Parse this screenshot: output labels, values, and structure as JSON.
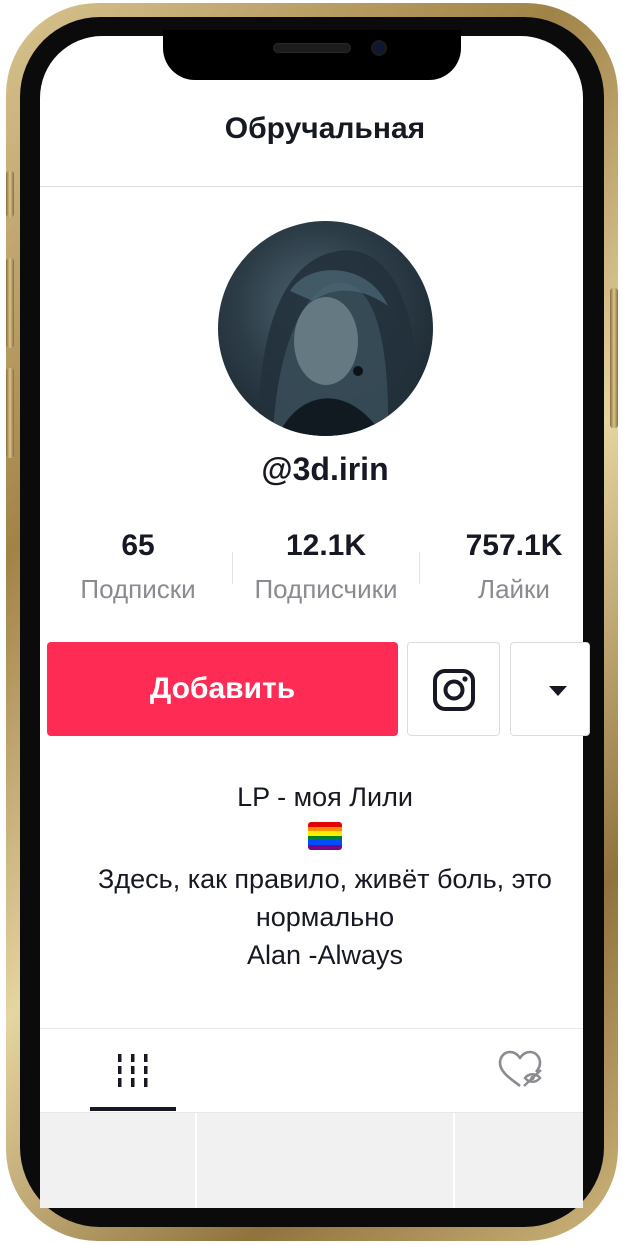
{
  "header": {
    "title": "Обручальная"
  },
  "profile": {
    "username": "@3d.irin"
  },
  "stats": [
    {
      "value": "65",
      "label": "Подписки"
    },
    {
      "value": "12.1K",
      "label": "Подписчики"
    },
    {
      "value": "757.1K",
      "label": "Лайки"
    }
  ],
  "actions": {
    "follow_label": "Добавить",
    "instagram_icon": "instagram-icon",
    "more_icon": "caret-down-icon"
  },
  "bio": {
    "lines": [
      "LP - моя Лили",
      "Здесь, как правило, живёт боль, это",
      "нормально",
      "Alan -Always"
    ],
    "emoji_icon": "pride-flag-icon"
  },
  "tabs": [
    {
      "icon": "grid-icon",
      "selected": true
    },
    {
      "icon": "liked-hidden-icon",
      "selected": false
    }
  ],
  "colors": {
    "accent": "#fe2c55",
    "text": "#161823",
    "muted": "#8a8b91",
    "frame_gold": "#c7ad73"
  }
}
